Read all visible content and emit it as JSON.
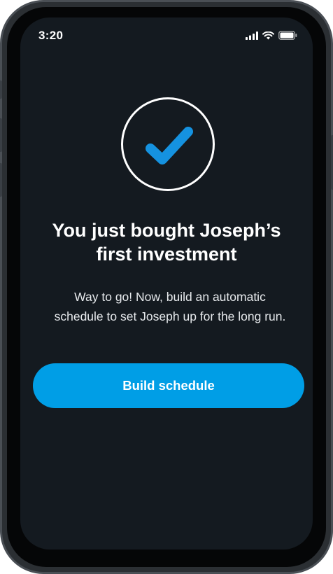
{
  "status_bar": {
    "time": "3:20",
    "icons": [
      "cellular-signal-icon",
      "wifi-icon",
      "battery-icon"
    ]
  },
  "success": {
    "icon": "checkmark-icon",
    "headline_line1": "You just bought Joseph’s",
    "headline_line2": "first investment",
    "subtext_line1": "Way to go! Now, build an automatic",
    "subtext_line2": "schedule to set Joseph up for the long run."
  },
  "actions": {
    "build_schedule_label": "Build schedule"
  },
  "colors": {
    "screen_background": "#141a20",
    "accent": "#009ee6",
    "check_color": "#1592e0",
    "text_primary": "#ffffff"
  }
}
